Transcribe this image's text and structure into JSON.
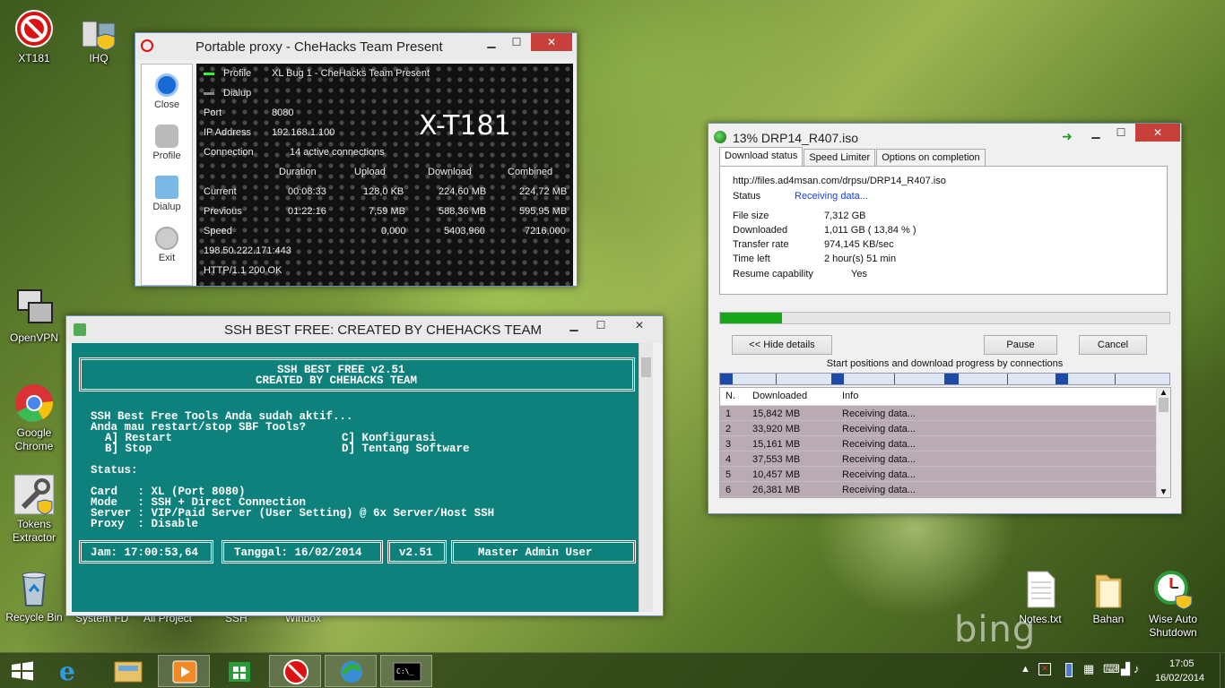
{
  "desktop": {
    "icons": [
      {
        "label": "XT181"
      },
      {
        "label": "IHQ"
      },
      {
        "label": "OpenVPN"
      },
      {
        "label": "Google Chrome"
      },
      {
        "label": "Tokens Extractor"
      },
      {
        "label": "Recycle Bin"
      },
      {
        "label": "Notes.txt"
      },
      {
        "label": "Bahan"
      },
      {
        "label": "Wise Auto Shutdown"
      }
    ],
    "partially_hidden_labels": [
      "System FD",
      "All Project",
      "SSH",
      "Winbox"
    ],
    "watermark": "bing"
  },
  "proxy": {
    "title": "Portable proxy - CheHacks Team Present",
    "sidebar": [
      "Close",
      "Profile",
      "Dialup",
      "Exit"
    ],
    "profile_label": "Profile",
    "profile_value": "XL Bug 1 - CheHacks Team Present",
    "dialup_label": "Dialup",
    "big_label": "X-T181",
    "port_label": "Port",
    "port_value": "8080",
    "ip_label": "IP Address",
    "ip_value": "192.168.1.100",
    "conn_label": "Connection",
    "conn_value": "14  active connections",
    "cols": [
      "Duration",
      "Upload",
      "Download",
      "Combined"
    ],
    "rows": [
      {
        "label": "Current",
        "vals": [
          "00:08:33",
          "128,0 KB",
          "224,60 MB",
          "224,72 MB"
        ]
      },
      {
        "label": "Previous",
        "vals": [
          "01:22:16",
          "7,59 MB",
          "588,36 MB",
          "595,95 MB"
        ]
      },
      {
        "label": "Speed",
        "vals": [
          "",
          "0,000",
          "5403,960",
          "7216,000"
        ]
      }
    ],
    "remote": "198.50.222.171:443",
    "http": "HTTP/1.1 200 OK"
  },
  "ssh": {
    "title": "SSH BEST FREE: CREATED BY CHEHACKS TEAM",
    "banner1": "SSH BEST FREE v2.51",
    "banner2": "CREATED BY CHEHACKS TEAM",
    "line1": "SSH Best Free Tools Anda sudah aktif...",
    "line2": "Anda mau restart/stop SBF Tools?",
    "optA": "A] Restart",
    "optB": "B] Stop",
    "optC": "C] Konfigurasi",
    "optD": "D] Tentang Software",
    "status": "Status:",
    "card": "Card   : XL (Port 8080)",
    "mode": "Mode   : SSH + Direct Connection",
    "server": "Server : VIP/Paid Server (User Setting) @ 6x Server/Host SSH",
    "proxy": "Proxy  : Disable",
    "jam": "Jam: 17:00:53,64",
    "tanggal": "Tanggal: 16/02/2014",
    "ver": "v2.51",
    "user": "Master Admin User"
  },
  "idm": {
    "title": "13% DRP14_R407.iso",
    "tabs": [
      "Download status",
      "Speed Limiter",
      "Options on completion"
    ],
    "url": "http://files.ad4msan.com/drpsu/DRP14_R407.iso",
    "status_label": "Status",
    "status_value": "Receiving data...",
    "filesize_label": "File size",
    "filesize_value": "7,312  GB",
    "downloaded_label": "Downloaded",
    "downloaded_value": "1,011  GB  ( 13,84 % )",
    "rate_label": "Transfer rate",
    "rate_value": "974,145  KB/sec",
    "timeleft_label": "Time left",
    "timeleft_value": "2 hour(s) 51 min",
    "resume_label": "Resume capability",
    "resume_value": "Yes",
    "progress": 0.1384,
    "hide_btn": "<< Hide details",
    "pause_btn": "Pause",
    "cancel_btn": "Cancel",
    "conn_caption": "Start positions and download progress by connections",
    "grid_headers": [
      "N.",
      "Downloaded",
      "Info"
    ],
    "grid_rows": [
      [
        "1",
        "15,842  MB",
        "Receiving data..."
      ],
      [
        "2",
        "33,920  MB",
        "Receiving data..."
      ],
      [
        "3",
        "15,161  MB",
        "Receiving data..."
      ],
      [
        "4",
        "37,553  MB",
        "Receiving data..."
      ],
      [
        "5",
        "10,457  MB",
        "Receiving data..."
      ],
      [
        "6",
        "26,381  MB",
        "Receiving data..."
      ]
    ]
  },
  "taskbar": {
    "time": "17:05",
    "date": "16/02/2014"
  },
  "colors": {
    "ssh_bg": "#0f817c",
    "close_red": "#c7413a",
    "progress_green": "#1aa61a",
    "status_blue": "#1a3fd8"
  }
}
